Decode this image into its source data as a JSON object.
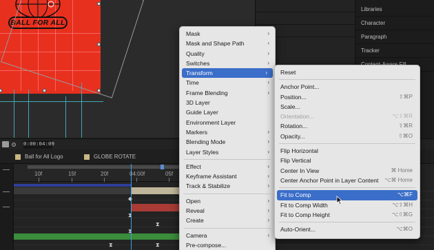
{
  "viewer": {
    "logo_text": "BALL FOR ALL",
    "timecode": "0:00:04:09"
  },
  "side_panel": {
    "items": [
      "Libraries",
      "Character",
      "Paragraph",
      "Tracker",
      "Content-Aware Fill"
    ]
  },
  "timeline_tabs": [
    {
      "label": "Ball for All Logo",
      "swatch_color": "#c9b783"
    },
    {
      "label": "GLOBE ROTATE",
      "swatch_color": "#c9b783"
    }
  ],
  "ruler": {
    "ticks": [
      "10f",
      "15f",
      "20f",
      "04:00f",
      "05f"
    ]
  },
  "keyframe_glyphs": {
    "diamond": "◆",
    "hourglass": "⧗",
    "bracket": "◀"
  },
  "main_menu": {
    "items": [
      {
        "label": "Mask",
        "submenu": true
      },
      {
        "label": "Mask and Shape Path",
        "submenu": true
      },
      {
        "label": "Quality",
        "submenu": true
      },
      {
        "label": "Switches",
        "submenu": true
      },
      {
        "label": "Transform",
        "submenu": true,
        "highlighted": true
      },
      {
        "label": "Time",
        "submenu": true
      },
      {
        "label": "Frame Blending",
        "submenu": true
      },
      {
        "label": "3D Layer",
        "submenu": false
      },
      {
        "label": "Guide Layer",
        "submenu": false
      },
      {
        "label": "Environment Layer",
        "submenu": false
      },
      {
        "label": "Markers",
        "submenu": true
      },
      {
        "label": "Blending Mode",
        "submenu": true
      },
      {
        "label": "Layer Styles",
        "submenu": true
      },
      {
        "separator": true
      },
      {
        "label": "Effect",
        "submenu": true
      },
      {
        "label": "Keyframe Assistant",
        "submenu": true
      },
      {
        "label": "Track & Stabilize",
        "submenu": true
      },
      {
        "separator": true
      },
      {
        "label": "Open",
        "submenu": true
      },
      {
        "label": "Reveal",
        "submenu": true
      },
      {
        "label": "Create",
        "submenu": true
      },
      {
        "separator": true
      },
      {
        "label": "Camera",
        "submenu": true
      },
      {
        "label": "Pre-compose...",
        "submenu": false
      }
    ]
  },
  "transform_submenu": {
    "items": [
      {
        "label": "Reset",
        "shortcut": ""
      },
      {
        "separator": true
      },
      {
        "label": "Anchor Point...",
        "shortcut": ""
      },
      {
        "label": "Position...",
        "shortcut": "⇧⌘P"
      },
      {
        "label": "Scale...",
        "shortcut": ""
      },
      {
        "label": "Orientation...",
        "shortcut": "⌥⇧⌘R",
        "disabled": true
      },
      {
        "label": "Rotation...",
        "shortcut": "⇧⌘R"
      },
      {
        "label": "Opacity...",
        "shortcut": "⇧⌘O"
      },
      {
        "separator": true
      },
      {
        "label": "Flip Horizontal",
        "shortcut": ""
      },
      {
        "label": "Flip Vertical",
        "shortcut": ""
      },
      {
        "label": "Center In View",
        "shortcut": "⌘ Home"
      },
      {
        "label": "Center Anchor Point in Layer Content",
        "shortcut": "⌥⌘ Home"
      },
      {
        "separator": true
      },
      {
        "label": "Fit to Comp",
        "shortcut": "⌥⌘F",
        "highlighted": true
      },
      {
        "label": "Fit to Comp Width",
        "shortcut": "⌥⇧⌘H"
      },
      {
        "label": "Fit to Comp Height",
        "shortcut": "⌥⇧⌘G"
      },
      {
        "separator": true
      },
      {
        "label": "Auto-Orient...",
        "shortcut": "⌥⌘O"
      }
    ]
  },
  "colors": {
    "layer_red": "#e8301f",
    "menu_bg": "#e6e6e6",
    "menu_highlight": "#3b6ec9",
    "guide_cyan": "#3fa9b8",
    "playhead_blue": "#3fa0e0",
    "track_tan": "#bfb59a",
    "track_red": "#a93b36",
    "track_green": "#3b8d3b",
    "track_blue": "#2f3f9a"
  }
}
